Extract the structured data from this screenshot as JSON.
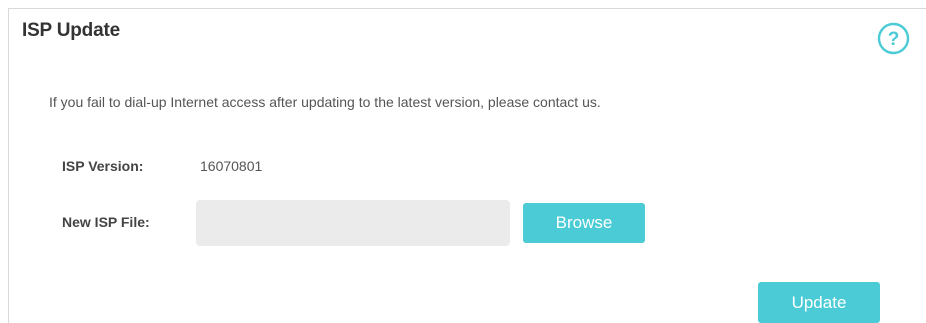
{
  "section": {
    "title": "ISP Update",
    "help_icon": "question-circle-icon"
  },
  "notice": "If you fail to dial-up Internet access after updating to the latest version, please contact us.",
  "fields": {
    "isp_version_label": "ISP Version:",
    "isp_version_value": "16070801",
    "new_isp_file_label": "New ISP File:",
    "new_isp_file_value": ""
  },
  "buttons": {
    "browse_label": "Browse",
    "update_label": "Update"
  },
  "colors": {
    "accent": "#4acbd6",
    "field_bg": "#ebebeb",
    "text": "#444444"
  }
}
